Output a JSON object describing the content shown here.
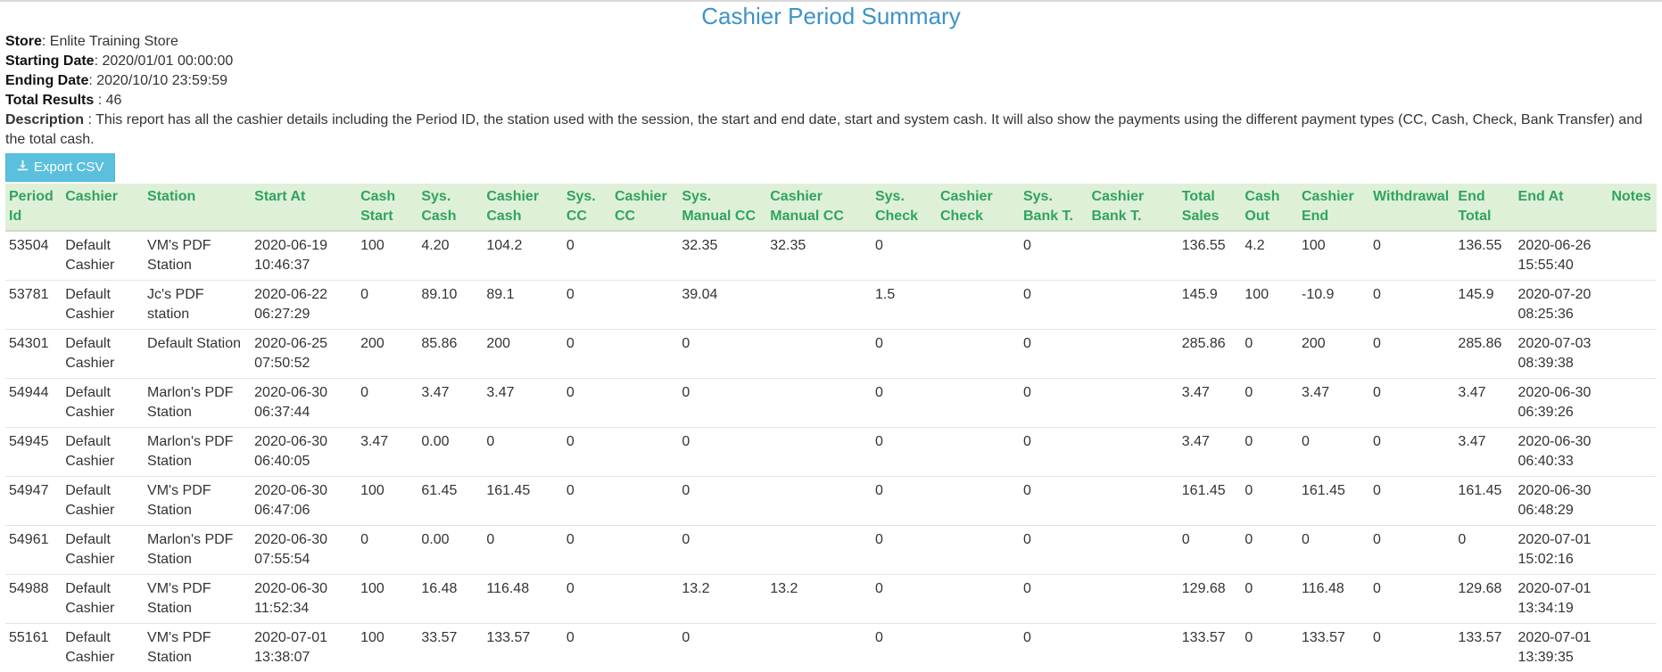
{
  "title": "Cashier Period Summary",
  "meta": {
    "store_label": "Store",
    "store_value": ": Enlite Training Store",
    "start_label": "Starting Date",
    "start_value": ": 2020/01/01 00:00:00",
    "end_label": "Ending Date",
    "end_value": ": 2020/10/10 23:59:59",
    "results_label": "Total Results",
    "results_value": " : 46",
    "desc_label": "Description",
    "desc_value": " : This report has all the cashier details including the Period ID, the station used with the session, the start and end date, start and system cash. It will also show the payments using the different payment types (CC, Cash, Check, Bank Transfer) and the total cash."
  },
  "export_label": "Export CSV",
  "icons": {
    "export": "download-icon"
  },
  "colors": {
    "title": "#3d93c8",
    "header_bg": "#dff0d8",
    "header_text": "#2fa460",
    "button_bg": "#5bc0de"
  },
  "table": {
    "headers": [
      "Period Id",
      "Cashier",
      "Station",
      "Start At",
      "Cash Start",
      "Sys. Cash",
      "Cashier Cash",
      "Sys. CC",
      "Cashier CC",
      "Sys. Manual CC",
      "Cashier Manual CC",
      "Sys. Check",
      "Cashier Check",
      "Sys. Bank T.",
      "Cashier Bank T.",
      "Total Sales",
      "Cash Out",
      "Cashier End",
      "Withdrawal",
      "End Total",
      "End At",
      "Notes"
    ],
    "rows": [
      [
        "53504",
        "Default Cashier",
        "VM's PDF Station",
        "2020-06-19 10:46:37",
        "100",
        "4.20",
        "104.2",
        "0",
        "",
        "32.35",
        "32.35",
        "0",
        "",
        "0",
        "",
        "136.55",
        "4.2",
        "100",
        "0",
        "136.55",
        "2020-06-26 15:55:40",
        ""
      ],
      [
        "53781",
        "Default Cashier",
        "Jc's PDF station",
        "2020-06-22 06:27:29",
        "0",
        "89.10",
        "89.1",
        "0",
        "",
        "39.04",
        "",
        "1.5",
        "",
        "0",
        "",
        "145.9",
        "100",
        "-10.9",
        "0",
        "145.9",
        "2020-07-20 08:25:36",
        ""
      ],
      [
        "54301",
        "Default Cashier",
        "Default Station",
        "2020-06-25 07:50:52",
        "200",
        "85.86",
        "200",
        "0",
        "",
        "0",
        "",
        "0",
        "",
        "0",
        "",
        "285.86",
        "0",
        "200",
        "0",
        "285.86",
        "2020-07-03 08:39:38",
        ""
      ],
      [
        "54944",
        "Default Cashier",
        "Marlon's PDF Station",
        "2020-06-30 06:37:44",
        "0",
        "3.47",
        "3.47",
        "0",
        "",
        "0",
        "",
        "0",
        "",
        "0",
        "",
        "3.47",
        "0",
        "3.47",
        "0",
        "3.47",
        "2020-06-30 06:39:26",
        ""
      ],
      [
        "54945",
        "Default Cashier",
        "Marlon's PDF Station",
        "2020-06-30 06:40:05",
        "3.47",
        "0.00",
        "0",
        "0",
        "",
        "0",
        "",
        "0",
        "",
        "0",
        "",
        "3.47",
        "0",
        "0",
        "0",
        "3.47",
        "2020-06-30 06:40:33",
        ""
      ],
      [
        "54947",
        "Default Cashier",
        "VM's PDF Station",
        "2020-06-30 06:47:06",
        "100",
        "61.45",
        "161.45",
        "0",
        "",
        "0",
        "",
        "0",
        "",
        "0",
        "",
        "161.45",
        "0",
        "161.45",
        "0",
        "161.45",
        "2020-06-30 06:48:29",
        ""
      ],
      [
        "54961",
        "Default Cashier",
        "Marlon's PDF Station",
        "2020-06-30 07:55:54",
        "0",
        "0.00",
        "0",
        "0",
        "",
        "0",
        "",
        "0",
        "",
        "0",
        "",
        "0",
        "0",
        "0",
        "0",
        "0",
        "2020-07-01 15:02:16",
        ""
      ],
      [
        "54988",
        "Default Cashier",
        "VM's PDF Station",
        "2020-06-30 11:52:34",
        "100",
        "16.48",
        "116.48",
        "0",
        "",
        "13.2",
        "13.2",
        "0",
        "",
        "0",
        "",
        "129.68",
        "0",
        "116.48",
        "0",
        "129.68",
        "2020-07-01 13:34:19",
        ""
      ],
      [
        "55161",
        "Default Cashier",
        "VM's PDF Station",
        "2020-07-01 13:38:07",
        "100",
        "33.57",
        "133.57",
        "0",
        "",
        "0",
        "",
        "0",
        "",
        "0",
        "",
        "133.57",
        "0",
        "133.57",
        "0",
        "133.57",
        "2020-07-01 13:39:35",
        ""
      ]
    ]
  }
}
